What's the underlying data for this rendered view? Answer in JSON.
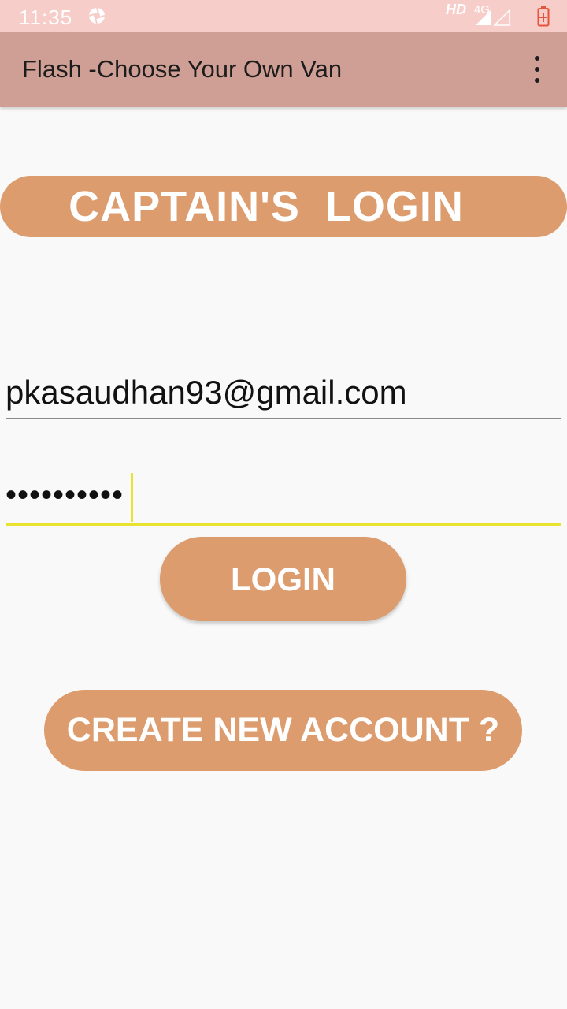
{
  "status_bar": {
    "time": "11:35",
    "hd": "HD",
    "network": "4G",
    "icons": [
      "aperture-icon",
      "signal-icon",
      "signal-empty-icon",
      "battery-charging-icon"
    ]
  },
  "app_bar": {
    "title": "Flash -Choose Your Own Van",
    "menu_icon": "more-vert-icon"
  },
  "heading": {
    "label": "CAPTAIN'S  LOGIN"
  },
  "form": {
    "email_value": "pkasaudhan93@gmail.com",
    "password_value": "••••••••••"
  },
  "buttons": {
    "login_label": "LOGIN",
    "create_account_label": "CREATE NEW ACCOUNT ?"
  },
  "colors": {
    "status_bar": "#f6cdc9",
    "app_bar": "#cf9f95",
    "accent_pill": "#dc9c6d",
    "focus_underline": "#e8e330",
    "background": "#f9f9f9"
  }
}
